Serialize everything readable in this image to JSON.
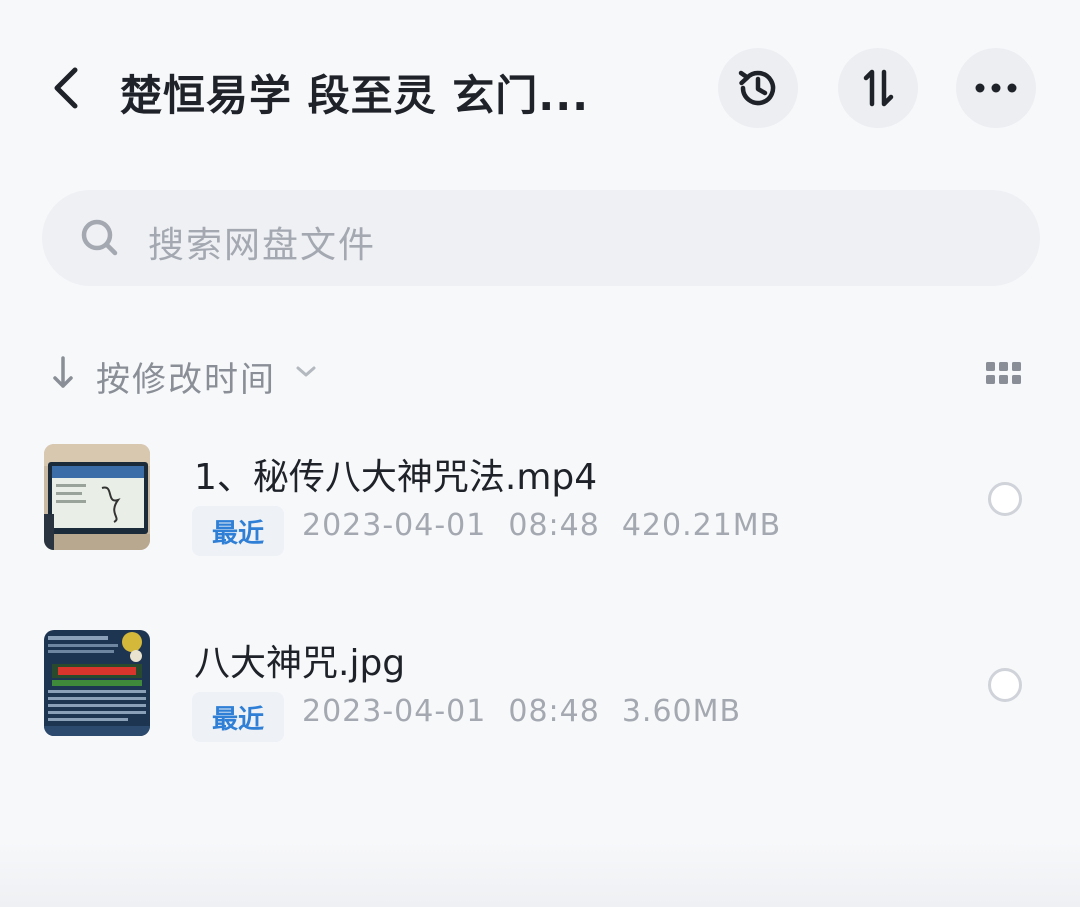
{
  "header": {
    "title": "楚恒易学  段至灵 玄门...",
    "icons": {
      "back": "chevron-left-icon",
      "history": "history-icon",
      "sort": "sort-toggle-icon",
      "more": "more-icon"
    }
  },
  "search": {
    "placeholder": "搜索网盘文件",
    "icon": "search-icon"
  },
  "sortbar": {
    "label": "按修改时间",
    "arrow": "arrow-down-icon",
    "view_toggle": "grid-view-icon"
  },
  "files": [
    {
      "name": "1、秘传八大神咒法.mp4",
      "badge": "最近",
      "date": "2023-04-01",
      "time": "08:48",
      "size": "420.21MB",
      "thumbnail": "video-thumbnail"
    },
    {
      "name": "八大神咒.jpg",
      "badge": "最近",
      "date": "2023-04-01",
      "time": "08:48",
      "size": "3.60MB",
      "thumbnail": "image-thumbnail"
    }
  ],
  "colors": {
    "accent": "#2f7fd6",
    "text": "#1f2329",
    "muted": "#a4a8b0",
    "background": "#f7f8fa"
  }
}
